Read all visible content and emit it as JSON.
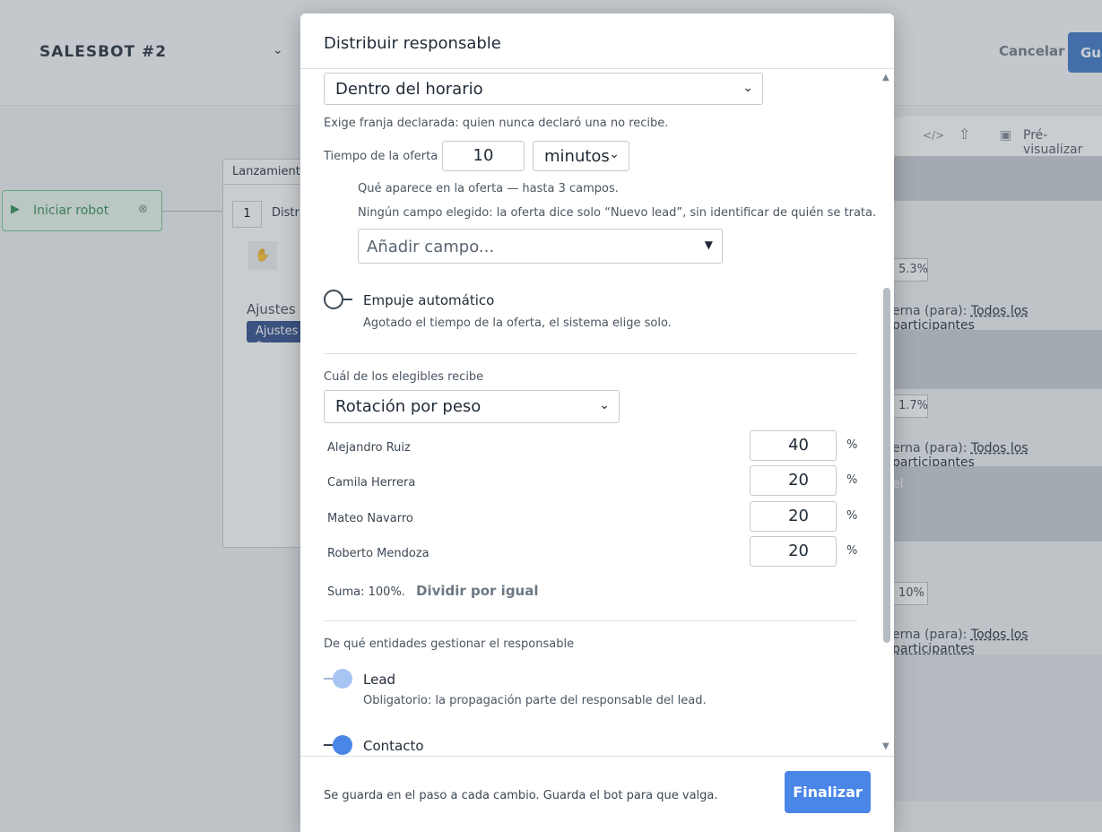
{
  "app": {
    "bot_title": "SALESBOT #2",
    "cancel_label": "Cancelar",
    "save_label": "Gua",
    "start_node_label": "Iniciar robot",
    "step_tab_label": "Lanzamiento",
    "step_number": "1",
    "step_name": "Distri",
    "step_settings_label": "Ajustes c",
    "step_badge_label": "Ajustes c",
    "preview_label": "Pré-visualizar",
    "right_rows": [
      {
        "pct": "5.3%",
        "interna": "erna (para):",
        "link": "Todos los participantes"
      },
      {
        "pct": "1.7%",
        "interna": "erna (para):",
        "link": "Todos los participantes"
      },
      {
        "pct": "10%",
        "interna": "erna (para):",
        "link": "Todos los participantes"
      }
    ],
    "right_el_text": "el"
  },
  "modal": {
    "title": "Distribuir responsable",
    "schedule_select": "Dentro del horario",
    "schedule_note": "Exige franja declarada: quien nunca declaró una no recibe.",
    "offer_time_label": "Tiempo de la oferta",
    "offer_time_value": "10",
    "offer_time_unit": "minutos",
    "offer_fields_note": "Qué aparece en la oferta — hasta 3 campos.",
    "offer_fields_empty_note": "Ningún campo elegido: la oferta dice solo “Nuevo lead”, sin identificar de quién se trata.",
    "add_field_placeholder": "Añadir campo...",
    "auto_push_title": "Empuje automático",
    "auto_push_note": "Agotado el tiempo de la oferta, el sistema elige solo.",
    "auto_push_on": false,
    "eligible_label": "Cuál de los elegibles recibe",
    "rotation_select": "Rotación por peso",
    "weights": [
      {
        "name": "Alejandro Ruiz",
        "value": "40",
        "unit": "%"
      },
      {
        "name": "Camila Herrera",
        "value": "20",
        "unit": "%"
      },
      {
        "name": "Mateo Navarro",
        "value": "20",
        "unit": "%"
      },
      {
        "name": "Roberto Mendoza",
        "value": "20",
        "unit": "%"
      }
    ],
    "sum_label": "Suma: 100%.",
    "split_equal_label": "Dividir por igual",
    "entities_label": "De qué entidades gestionar el responsable",
    "lead_title": "Lead",
    "lead_note": "Obligatorio: la propagación parte del responsable del lead.",
    "contact_title": "Contacto",
    "footer_note": "Se guarda en el paso a cada cambio. Guarda el bot para que valga.",
    "finish_label": "Finalizar"
  },
  "colors": {
    "accent": "#4a86e8",
    "start_node": "#2e8c52",
    "badge": "#2d4b8a"
  }
}
